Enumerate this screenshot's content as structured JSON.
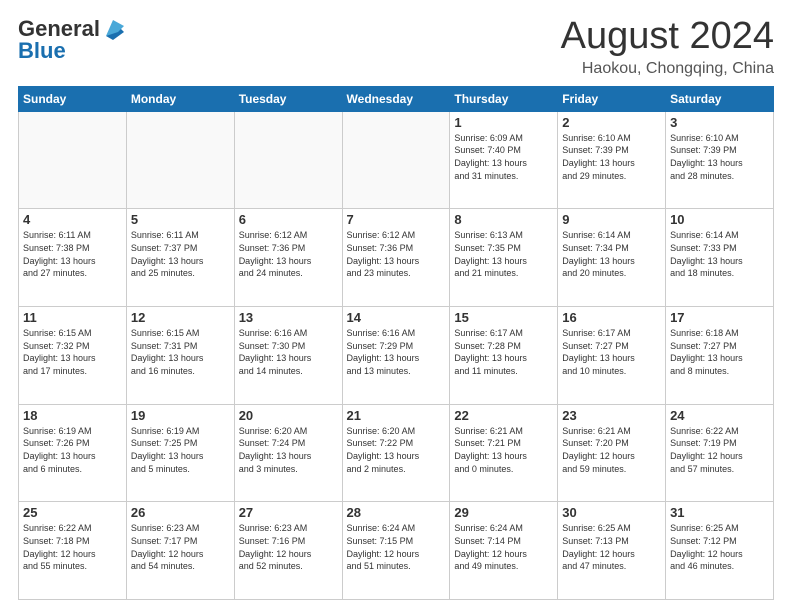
{
  "logo": {
    "general": "General",
    "blue": "Blue"
  },
  "header": {
    "month": "August 2024",
    "location": "Haokou, Chongqing, China"
  },
  "weekdays": [
    "Sunday",
    "Monday",
    "Tuesday",
    "Wednesday",
    "Thursday",
    "Friday",
    "Saturday"
  ],
  "weeks": [
    [
      {
        "day": "",
        "info": ""
      },
      {
        "day": "",
        "info": ""
      },
      {
        "day": "",
        "info": ""
      },
      {
        "day": "",
        "info": ""
      },
      {
        "day": "1",
        "info": "Sunrise: 6:09 AM\nSunset: 7:40 PM\nDaylight: 13 hours\nand 31 minutes."
      },
      {
        "day": "2",
        "info": "Sunrise: 6:10 AM\nSunset: 7:39 PM\nDaylight: 13 hours\nand 29 minutes."
      },
      {
        "day": "3",
        "info": "Sunrise: 6:10 AM\nSunset: 7:39 PM\nDaylight: 13 hours\nand 28 minutes."
      }
    ],
    [
      {
        "day": "4",
        "info": "Sunrise: 6:11 AM\nSunset: 7:38 PM\nDaylight: 13 hours\nand 27 minutes."
      },
      {
        "day": "5",
        "info": "Sunrise: 6:11 AM\nSunset: 7:37 PM\nDaylight: 13 hours\nand 25 minutes."
      },
      {
        "day": "6",
        "info": "Sunrise: 6:12 AM\nSunset: 7:36 PM\nDaylight: 13 hours\nand 24 minutes."
      },
      {
        "day": "7",
        "info": "Sunrise: 6:12 AM\nSunset: 7:36 PM\nDaylight: 13 hours\nand 23 minutes."
      },
      {
        "day": "8",
        "info": "Sunrise: 6:13 AM\nSunset: 7:35 PM\nDaylight: 13 hours\nand 21 minutes."
      },
      {
        "day": "9",
        "info": "Sunrise: 6:14 AM\nSunset: 7:34 PM\nDaylight: 13 hours\nand 20 minutes."
      },
      {
        "day": "10",
        "info": "Sunrise: 6:14 AM\nSunset: 7:33 PM\nDaylight: 13 hours\nand 18 minutes."
      }
    ],
    [
      {
        "day": "11",
        "info": "Sunrise: 6:15 AM\nSunset: 7:32 PM\nDaylight: 13 hours\nand 17 minutes."
      },
      {
        "day": "12",
        "info": "Sunrise: 6:15 AM\nSunset: 7:31 PM\nDaylight: 13 hours\nand 16 minutes."
      },
      {
        "day": "13",
        "info": "Sunrise: 6:16 AM\nSunset: 7:30 PM\nDaylight: 13 hours\nand 14 minutes."
      },
      {
        "day": "14",
        "info": "Sunrise: 6:16 AM\nSunset: 7:29 PM\nDaylight: 13 hours\nand 13 minutes."
      },
      {
        "day": "15",
        "info": "Sunrise: 6:17 AM\nSunset: 7:28 PM\nDaylight: 13 hours\nand 11 minutes."
      },
      {
        "day": "16",
        "info": "Sunrise: 6:17 AM\nSunset: 7:27 PM\nDaylight: 13 hours\nand 10 minutes."
      },
      {
        "day": "17",
        "info": "Sunrise: 6:18 AM\nSunset: 7:27 PM\nDaylight: 13 hours\nand 8 minutes."
      }
    ],
    [
      {
        "day": "18",
        "info": "Sunrise: 6:19 AM\nSunset: 7:26 PM\nDaylight: 13 hours\nand 6 minutes."
      },
      {
        "day": "19",
        "info": "Sunrise: 6:19 AM\nSunset: 7:25 PM\nDaylight: 13 hours\nand 5 minutes."
      },
      {
        "day": "20",
        "info": "Sunrise: 6:20 AM\nSunset: 7:24 PM\nDaylight: 13 hours\nand 3 minutes."
      },
      {
        "day": "21",
        "info": "Sunrise: 6:20 AM\nSunset: 7:22 PM\nDaylight: 13 hours\nand 2 minutes."
      },
      {
        "day": "22",
        "info": "Sunrise: 6:21 AM\nSunset: 7:21 PM\nDaylight: 13 hours\nand 0 minutes."
      },
      {
        "day": "23",
        "info": "Sunrise: 6:21 AM\nSunset: 7:20 PM\nDaylight: 12 hours\nand 59 minutes."
      },
      {
        "day": "24",
        "info": "Sunrise: 6:22 AM\nSunset: 7:19 PM\nDaylight: 12 hours\nand 57 minutes."
      }
    ],
    [
      {
        "day": "25",
        "info": "Sunrise: 6:22 AM\nSunset: 7:18 PM\nDaylight: 12 hours\nand 55 minutes."
      },
      {
        "day": "26",
        "info": "Sunrise: 6:23 AM\nSunset: 7:17 PM\nDaylight: 12 hours\nand 54 minutes."
      },
      {
        "day": "27",
        "info": "Sunrise: 6:23 AM\nSunset: 7:16 PM\nDaylight: 12 hours\nand 52 minutes."
      },
      {
        "day": "28",
        "info": "Sunrise: 6:24 AM\nSunset: 7:15 PM\nDaylight: 12 hours\nand 51 minutes."
      },
      {
        "day": "29",
        "info": "Sunrise: 6:24 AM\nSunset: 7:14 PM\nDaylight: 12 hours\nand 49 minutes."
      },
      {
        "day": "30",
        "info": "Sunrise: 6:25 AM\nSunset: 7:13 PM\nDaylight: 12 hours\nand 47 minutes."
      },
      {
        "day": "31",
        "info": "Sunrise: 6:25 AM\nSunset: 7:12 PM\nDaylight: 12 hours\nand 46 minutes."
      }
    ]
  ]
}
